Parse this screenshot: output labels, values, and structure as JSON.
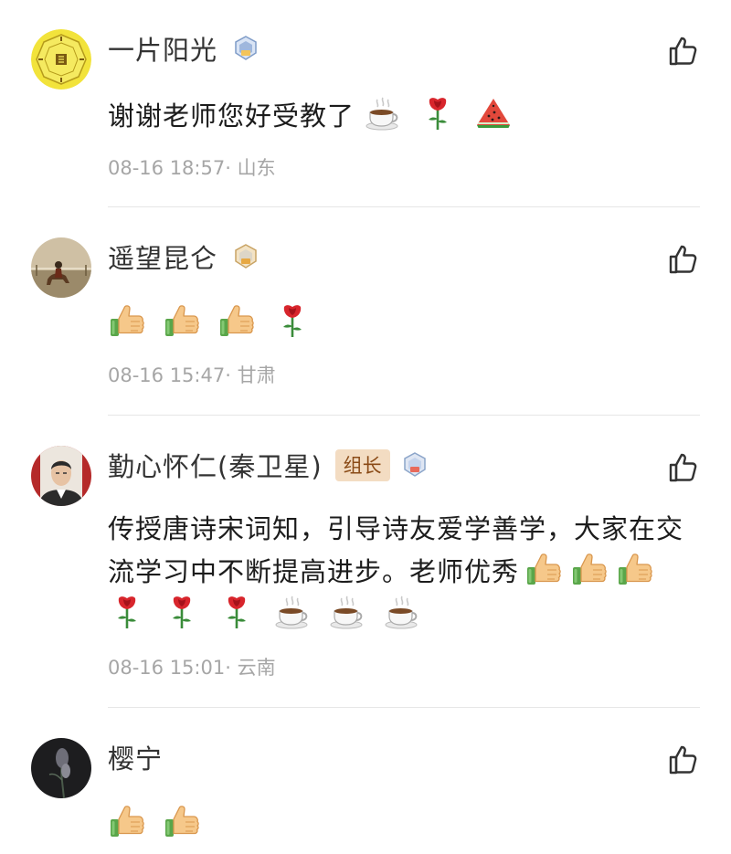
{
  "comments": [
    {
      "name": "一片阳光",
      "role": "",
      "text": "谢谢老师您好受教了",
      "emojis": [
        "coffee",
        "rose",
        "watermelon"
      ],
      "time": "08-16 18:57·",
      "location": "山东"
    },
    {
      "name": "遥望昆仑",
      "role": "",
      "text": "",
      "emojis": [
        "thumbs-up",
        "thumbs-up",
        "thumbs-up",
        "rose"
      ],
      "time": "08-16 15:47·",
      "location": "甘肃"
    },
    {
      "name": "勤心怀仁(秦卫星)",
      "role": "组长",
      "text_line1": "传授唐诗宋词知，引导诗友爱学善学，大家在交",
      "text_line2": "流学习中不断提高进步。老师优秀",
      "emojis_line2": [
        "thumbs-up",
        "thumbs-up",
        "thumbs-up"
      ],
      "emojis_line3": [
        "rose",
        "rose",
        "rose",
        "coffee",
        "coffee",
        "coffee"
      ],
      "time": "08-16 15:01·",
      "location": "云南"
    },
    {
      "name": "樱宁",
      "role": "",
      "text": "",
      "emojis": [
        "thumbs-up",
        "thumbs-up"
      ]
    }
  ],
  "icons": {
    "like": "thumbs-up-outline-icon",
    "badge": "level-badge-icon"
  },
  "colors": {
    "role_badge_bg": "#f3dcc2",
    "role_badge_text": "#8a4a16",
    "meta_text": "#a6a6a6"
  }
}
